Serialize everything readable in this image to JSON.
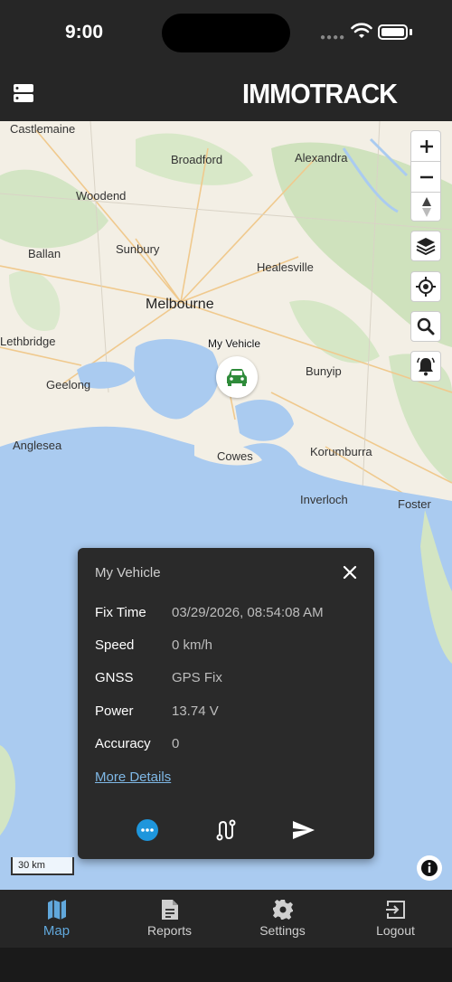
{
  "status_bar": {
    "time": "9:00"
  },
  "header": {
    "logo_text": "IMMOTRACK",
    "menu_icon": "server-list-icon"
  },
  "map": {
    "places": [
      {
        "name": "Castlemaine"
      },
      {
        "name": "Broadford"
      },
      {
        "name": "Alexandra"
      },
      {
        "name": "Woodend"
      },
      {
        "name": "Sunbury"
      },
      {
        "name": "Ballan"
      },
      {
        "name": "Healesville"
      },
      {
        "name": "Melbourne"
      },
      {
        "name": "Lethbridge"
      },
      {
        "name": "Geelong"
      },
      {
        "name": "Bunyip"
      },
      {
        "name": "Anglesea"
      },
      {
        "name": "Cowes"
      },
      {
        "name": "Korumburra"
      },
      {
        "name": "Inverloch"
      },
      {
        "name": "Foster"
      }
    ],
    "vehicle_label": "My Vehicle",
    "scale_label": "30 km",
    "controls": [
      "zoom-in-icon",
      "zoom-out-icon",
      "compass-icon",
      "layers-icon",
      "locate-icon",
      "search-icon",
      "bell-icon"
    ]
  },
  "popup": {
    "title": "My Vehicle",
    "rows": [
      {
        "label": "Fix Time",
        "value": "03/29/2026, 08:54:08 AM"
      },
      {
        "label": "Speed",
        "value": "0 km/h"
      },
      {
        "label": "GNSS",
        "value": "GPS Fix"
      },
      {
        "label": "Power",
        "value": "13.74 V"
      },
      {
        "label": "Accuracy",
        "value": "0"
      }
    ],
    "more_link": "More Details",
    "accent_color": "#1e96dc"
  },
  "nav": {
    "items": [
      {
        "label": "Map",
        "icon": "map-icon",
        "active": true
      },
      {
        "label": "Reports",
        "icon": "report-icon",
        "active": false
      },
      {
        "label": "Settings",
        "icon": "gear-icon",
        "active": false
      },
      {
        "label": "Logout",
        "icon": "logout-icon",
        "active": false
      }
    ]
  }
}
